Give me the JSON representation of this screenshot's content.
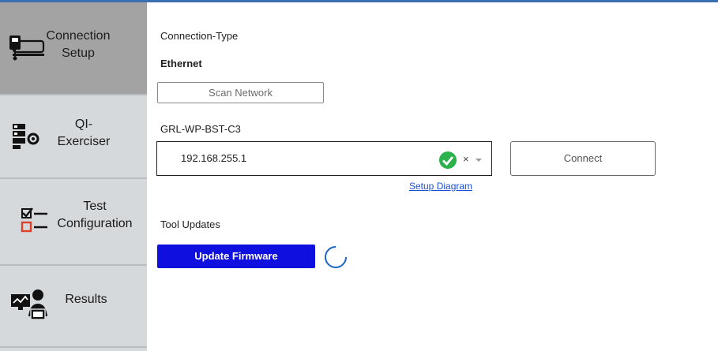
{
  "sidebar": {
    "items": [
      {
        "label": "Connection\nSetup",
        "icon": "connection-setup-icon",
        "active": true
      },
      {
        "label": "QI-\nExerciser",
        "icon": "qi-exerciser-icon",
        "active": false
      },
      {
        "label": "Test\nConfiguration",
        "icon": "test-configuration-icon",
        "active": false
      },
      {
        "label": "Results",
        "icon": "results-icon",
        "active": false
      }
    ]
  },
  "main": {
    "connection_type_label": "Connection-Type",
    "connection_type_value": "Ethernet",
    "scan_button": "Scan Network",
    "device_label": "GRL-WP-BST-C3",
    "ip_value": "192.168.255.1",
    "clear_symbol": "×",
    "connect_button": "Connect",
    "setup_diagram_link": "Setup Diagram",
    "tool_updates_label": "Tool Updates",
    "update_firmware_button": "Update Firmware"
  },
  "colors": {
    "accent_top": "#3b6fb0",
    "sidebar_bg": "#d5d9dc",
    "sidebar_active": "#a3a3a3",
    "primary_button": "#0f0fe0",
    "status_ok": "#2bb24c",
    "link": "#1a4fd8"
  }
}
